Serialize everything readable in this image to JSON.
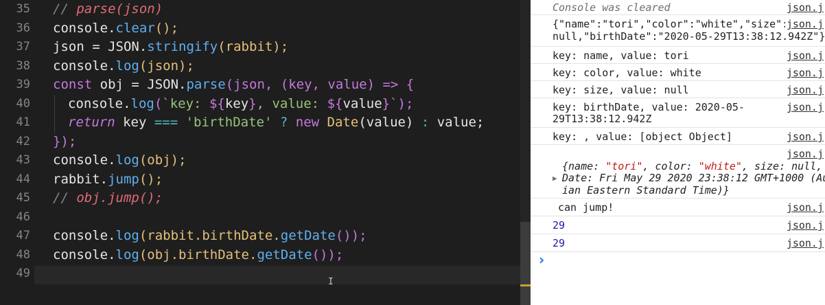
{
  "editor": {
    "line_numbers": [
      "35",
      "36",
      "37",
      "38",
      "39",
      "40",
      "41",
      "42",
      "43",
      "44",
      "45",
      "46",
      "47",
      "48",
      "49"
    ],
    "lines": {
      "l35": {
        "p0": "// ",
        "p1": "parse(json)"
      },
      "l36": {
        "p0": "console.",
        "p1": "clear",
        "p2": "();"
      },
      "l37": {
        "p0": "json = JSON.",
        "p1": "stringify",
        "p2": "(rabbit);"
      },
      "l38": {
        "p0": "console.",
        "p1": "log",
        "p2": "(json);"
      },
      "l39": {
        "p0": "const ",
        "p1": "obj = JSON.",
        "p2": "parse",
        "p3": "(json, (key, value) ",
        "p4": "=>",
        "p5": " {"
      },
      "l40": {
        "p0": "console.",
        "p1": "log",
        "p2": "(`",
        "p3": "key: ",
        "p4": "${",
        "p5": "key",
        "p6": "}",
        "p7": ", value: ",
        "p8": "${",
        "p9": "value",
        "p10": "}",
        "p11": "`);"
      },
      "l41": {
        "p0": "return",
        "p1": " key ",
        "p2": "===",
        "p3": " 'birthDate' ",
        "p4": "?",
        "p5": " new ",
        "p6": "Date",
        "p7": "(value) ",
        "p8": ":",
        "p9": " value;"
      },
      "l42": {
        "p0": "});"
      },
      "l43": {
        "p0": "console.",
        "p1": "log",
        "p2": "(obj);"
      },
      "l44": {
        "p0": "rabbit.",
        "p1": "jump",
        "p2": "();"
      },
      "l45": {
        "p0": "// ",
        "p1": "obj.jump();"
      },
      "l47": {
        "p0": "console.",
        "p1": "log",
        "p2": "(rabbit.birthDate.",
        "p3": "getDate",
        "p4": "());"
      },
      "l48": {
        "p0": "console.",
        "p1": "log",
        "p2": "(obj.birthDate.",
        "p3": "getDate",
        "p4": "());"
      }
    },
    "cursor_glyph": "I"
  },
  "console": {
    "cleared": "Console was cleared",
    "source": "json.j",
    "source_first": "json.j",
    "json_line1": "{\"name\":\"tori\",\"color\":\"white\",\"size\":",
    "json_line2": "null,\"birthDate\":\"2020-05-29T13:38:12.942Z\"}",
    "key_name": "key: name, value: tori",
    "key_color": "key: color, value: white",
    "key_size": "key: size, value: null",
    "key_birth1": "key: birthDate, value: 2020-05-",
    "key_birth2": "29T13:38:12.942Z",
    "key_empty": "key: , value: [object Object]",
    "obj": {
      "l1_a": "{name: ",
      "l1_b": "\"tori\"",
      "l1_c": ", color: ",
      "l1_d": "\"white\"",
      "l1_e": ", size: null, ",
      "arrow": "▶",
      "l2": "Date: Fri May 29 2020 23:38:12 GMT+1000 (Au",
      "l3": "ian Eastern Standard Time)}"
    },
    "can_jump": "can jump!",
    "n1": "29",
    "n2": "29",
    "prompt": "›"
  }
}
